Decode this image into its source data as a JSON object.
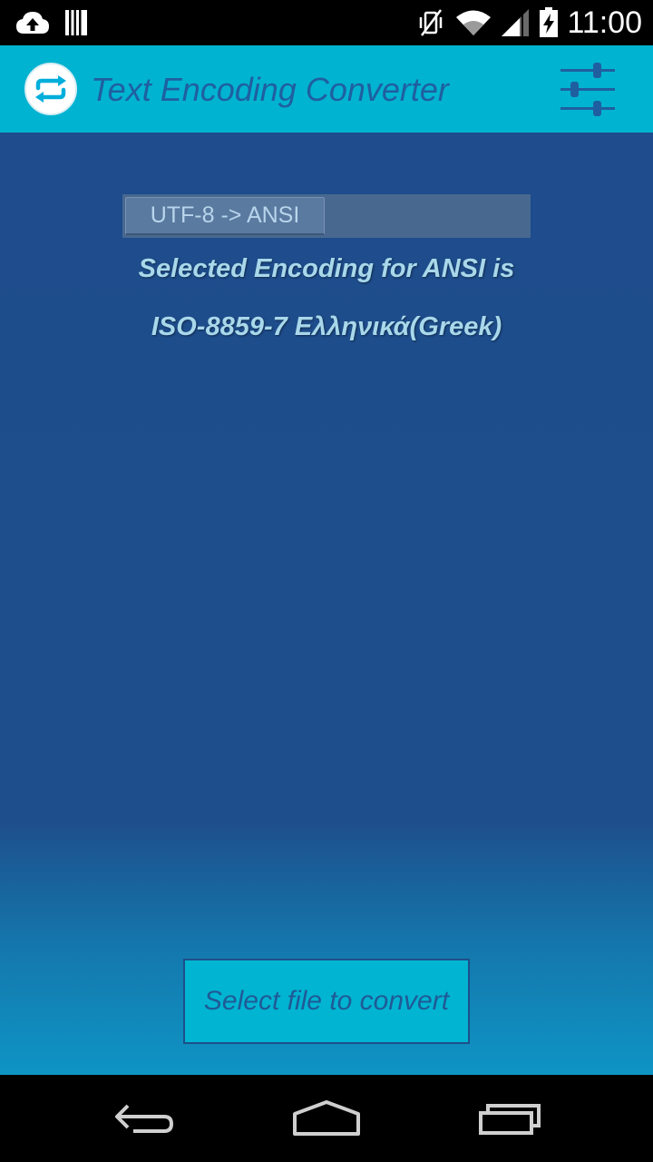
{
  "status_bar": {
    "time": "11:00",
    "icons": [
      "cloud-upload-icon",
      "sd-card-icon",
      "vibrate-off-icon",
      "wifi-icon",
      "cell-signal-icon",
      "battery-charging-icon"
    ]
  },
  "action_bar": {
    "logo_icon": "sync-arrows-icon",
    "title": "Text Encoding Converter",
    "settings_icon": "sliders-icon"
  },
  "main": {
    "mode_toggle_label": "UTF-8 -> ANSI",
    "info_line_1": "Selected Encoding for ANSI is",
    "info_line_2": "ISO-8859-7 Ελληνικά(Greek)",
    "select_file_label": "Select file to convert"
  },
  "nav_bar": {
    "icons": [
      "back-icon",
      "home-icon",
      "recent-apps-icon"
    ]
  },
  "colors": {
    "action_bar": "#00b3d1",
    "background": "#1e4f8c",
    "info_text": "#a8d8ea",
    "title_text": "#1f5fa0"
  }
}
